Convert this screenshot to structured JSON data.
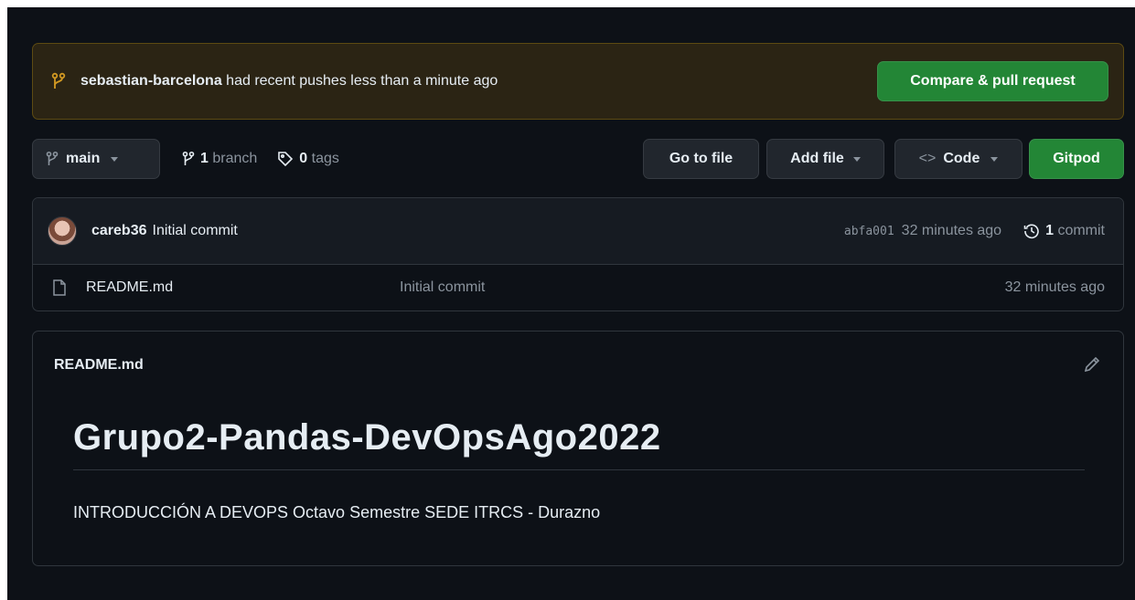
{
  "banner": {
    "user": "sebastian-barcelona",
    "message": " had recent pushes less than a minute ago",
    "button_label": "Compare & pull request",
    "icon": "git-branch-icon"
  },
  "toolbar": {
    "branch_label": "main",
    "branch_count": "1",
    "branch_text": "branch",
    "tag_count": "0",
    "tag_text": "tags",
    "go_to_file": "Go to file",
    "add_file": "Add file",
    "code": "Code",
    "gitpod": "Gitpod"
  },
  "latest_commit": {
    "author": "careb36",
    "message": "Initial commit",
    "sha": "abfa001",
    "time": "32 minutes ago",
    "commit_count": "1",
    "commit_text": "commit"
  },
  "files": [
    {
      "name": "README.md",
      "message": "Initial commit",
      "time": "32 minutes ago",
      "icon": "file-icon"
    }
  ],
  "readme": {
    "header": "README.md",
    "title": "Grupo2-Pandas-DevOpsAgo2022",
    "body": "INTRODUCCIÓN A DEVOPS Octavo Semestre SEDE ITRCS - Durazno"
  },
  "colors": {
    "background": "#0d1117",
    "accent_green": "#238636",
    "banner_bg": "#2b2414",
    "banner_icon": "#d29922",
    "muted": "#8b949e",
    "border": "#30363d"
  }
}
